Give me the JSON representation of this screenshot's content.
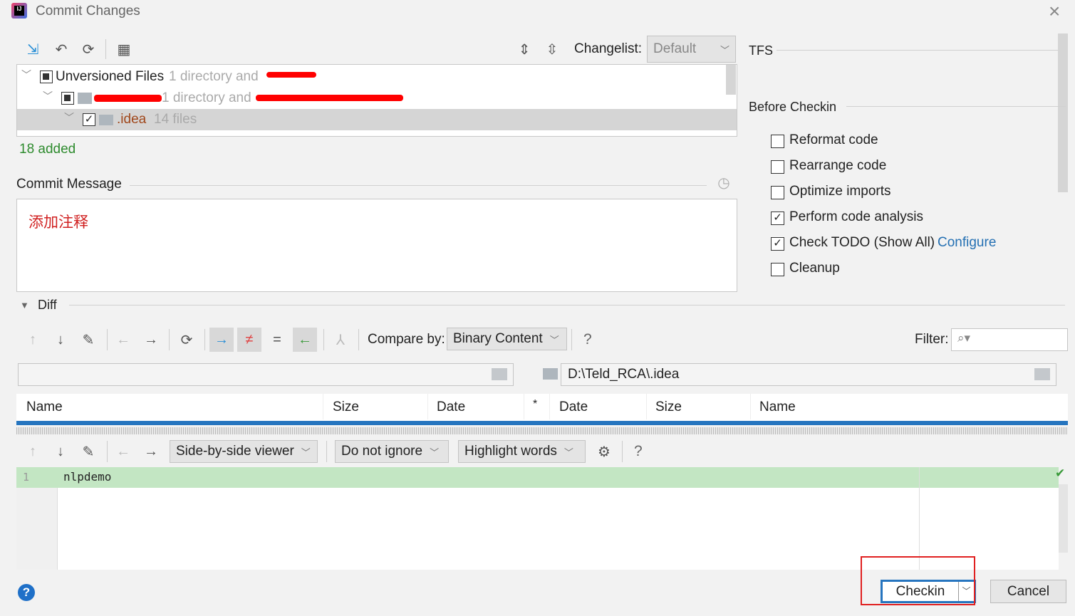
{
  "window": {
    "title": "Commit Changes",
    "app_icon": "intellij-idea-icon",
    "close": "×"
  },
  "toolbar": {
    "changelist_label": "Changelist:",
    "changelist_value": "Default"
  },
  "tree": {
    "items": [
      {
        "label": "Unversioned Files",
        "info": "1 directory and",
        "state": "partial"
      },
      {
        "label": "",
        "info": "1 directory and",
        "state": "partial"
      },
      {
        "label": ".idea",
        "info": "14 files",
        "state": "checked"
      }
    ]
  },
  "status": "18 added",
  "commit": {
    "label": "Commit Message",
    "message": "添加注释"
  },
  "right": {
    "tfs": "TFS",
    "before_checkin": "Before Checkin",
    "options": [
      {
        "label": "Reformat code",
        "checked": false
      },
      {
        "label": "Rearrange code",
        "checked": false
      },
      {
        "label": "Optimize imports",
        "checked": false
      },
      {
        "label": "Perform code analysis",
        "checked": true
      },
      {
        "label": "Check TODO (Show All)",
        "checked": true,
        "link": "Configure"
      },
      {
        "label": "Cleanup",
        "checked": false
      }
    ]
  },
  "diff": {
    "label": "Diff",
    "compare_label": "Compare by:",
    "compare_value": "Binary Content",
    "help": "?",
    "filter_label": "Filter:",
    "left_path": "",
    "right_path": "D:\\Teld_RCA\\.idea",
    "columns": [
      "Name",
      "Size",
      "Date",
      "*",
      "Date",
      "Size",
      "Name"
    ],
    "viewer": "Side-by-side viewer",
    "ignore": "Do not ignore",
    "highlight": "Highlight words",
    "lines": [
      {
        "num": "1",
        "text": "nlpdemo"
      }
    ]
  },
  "buttons": {
    "checkin": "Checkin",
    "cancel": "Cancel",
    "help": "?"
  },
  "colors": {
    "accent": "#2675bf",
    "added": "#2e8b2e",
    "link": "#2470b3",
    "diff_added_bg": "#c3e6c3",
    "annotation": "#e02020"
  }
}
